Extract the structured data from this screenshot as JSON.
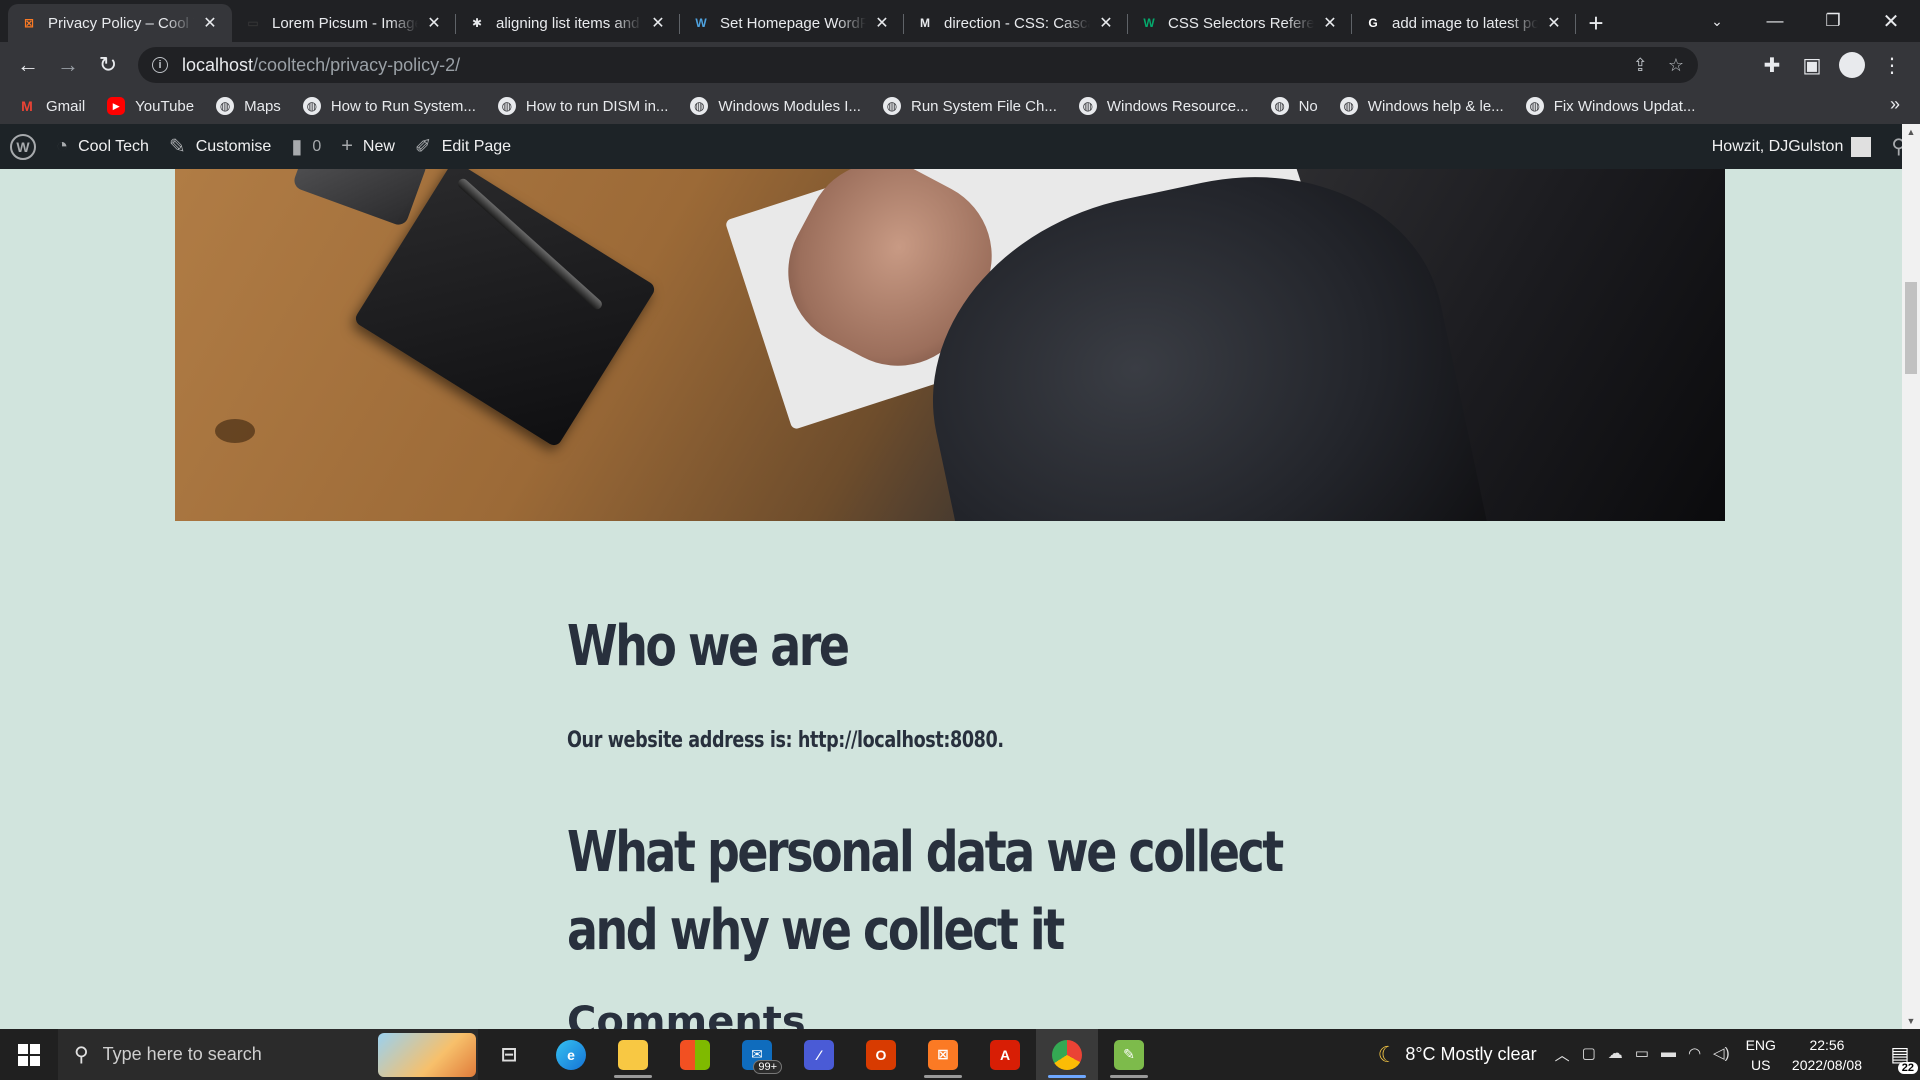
{
  "browser": {
    "tabs": [
      {
        "title": "Privacy Policy – Cool T",
        "icon": "xampp-icon",
        "icon_glyph": "⊠",
        "icon_color": "#fb7a24",
        "active": true
      },
      {
        "title": "Lorem Picsum - Image",
        "icon": "picsum-icon",
        "icon_glyph": "▭",
        "icon_color": "#3c3c3c",
        "active": false
      },
      {
        "title": "aligning list items and",
        "icon": "asterisk-icon",
        "icon_glyph": "✱",
        "icon_color": "#e8eaed",
        "active": false
      },
      {
        "title": "Set Homepage WordP",
        "icon": "wordpress-icon",
        "icon_glyph": "W",
        "icon_color": "#4fa3e0",
        "active": false
      },
      {
        "title": "direction - CSS: Casca",
        "icon": "mdn-icon",
        "icon_glyph": "M",
        "icon_color": "#e8eaed",
        "active": false
      },
      {
        "title": "CSS Selectors Referen",
        "icon": "w3schools-icon",
        "icon_glyph": "W",
        "icon_color": "#04aa6d",
        "active": false
      },
      {
        "title": "add image to latest po",
        "icon": "google-icon",
        "icon_glyph": "G",
        "icon_color": "#ffffff",
        "active": false
      }
    ],
    "new_tab_glyph": "+",
    "url_host": "localhost",
    "url_path": "/cooltech/privacy-policy-2/",
    "bookmarks": [
      {
        "label": "Gmail",
        "icon": "gmail-icon",
        "glyph": "M"
      },
      {
        "label": "YouTube",
        "icon": "youtube-icon",
        "glyph": "▶"
      },
      {
        "label": "Maps",
        "icon": "globe-icon",
        "glyph": "◍"
      },
      {
        "label": "How to Run System...",
        "icon": "globe-icon",
        "glyph": "◍"
      },
      {
        "label": "How to run DISM in...",
        "icon": "globe-icon",
        "glyph": "◍"
      },
      {
        "label": "Windows Modules I...",
        "icon": "globe-icon",
        "glyph": "◍"
      },
      {
        "label": "Run System File Ch...",
        "icon": "globe-icon",
        "glyph": "◍"
      },
      {
        "label": "Windows Resource...",
        "icon": "globe-icon",
        "glyph": "◍"
      },
      {
        "label": "No",
        "icon": "globe-icon",
        "glyph": "◍"
      },
      {
        "label": "Windows help & le...",
        "icon": "globe-icon",
        "glyph": "◍"
      },
      {
        "label": "Fix Windows Updat...",
        "icon": "globe-icon",
        "glyph": "◍"
      }
    ],
    "bookmarks_more": "»"
  },
  "wp_admin_bar": {
    "site_name": "Cool Tech",
    "customise": "Customise",
    "comments_count": "0",
    "new": "New",
    "edit_page": "Edit Page",
    "greeting": "Howzit, DJGulston"
  },
  "page": {
    "heading_who": "Who we are",
    "site_address": "Our website address is: http://localhost:8080.",
    "heading_what": "What personal data we collect and why we collect it",
    "heading_comments": "Comments"
  },
  "taskbar": {
    "search_placeholder": "Type here to search",
    "mail_badge": "99+",
    "weather": "8°C  Mostly clear",
    "lang_line1": "ENG",
    "lang_line2": "US",
    "time": "22:56",
    "date": "2022/08/08",
    "notifications": "22"
  },
  "colors": {
    "page_background": "#d1e4dd",
    "heading_text": "#28303d",
    "admin_bar": "#1d2327"
  }
}
